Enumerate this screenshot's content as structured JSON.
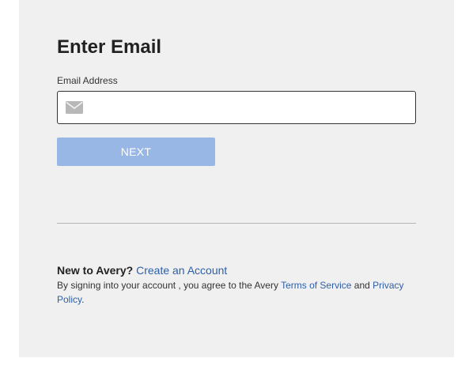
{
  "form": {
    "title": "Enter Email",
    "email_label": "Email Address",
    "email_value": "",
    "email_placeholder": "",
    "email_icon": "envelope-icon",
    "next_label": "NEXT",
    "next_color": "#98b7e4"
  },
  "footer": {
    "new_prefix": "New to Avery?",
    "create_account_link": "Create an Account",
    "terms_text": "By signing into your account , you agree to the Avery",
    "terms_link": "Terms of Service",
    "and_text": "and",
    "privacy_link": "Privacy Policy",
    "period": ".",
    "link_color": "#2d5fa8"
  }
}
